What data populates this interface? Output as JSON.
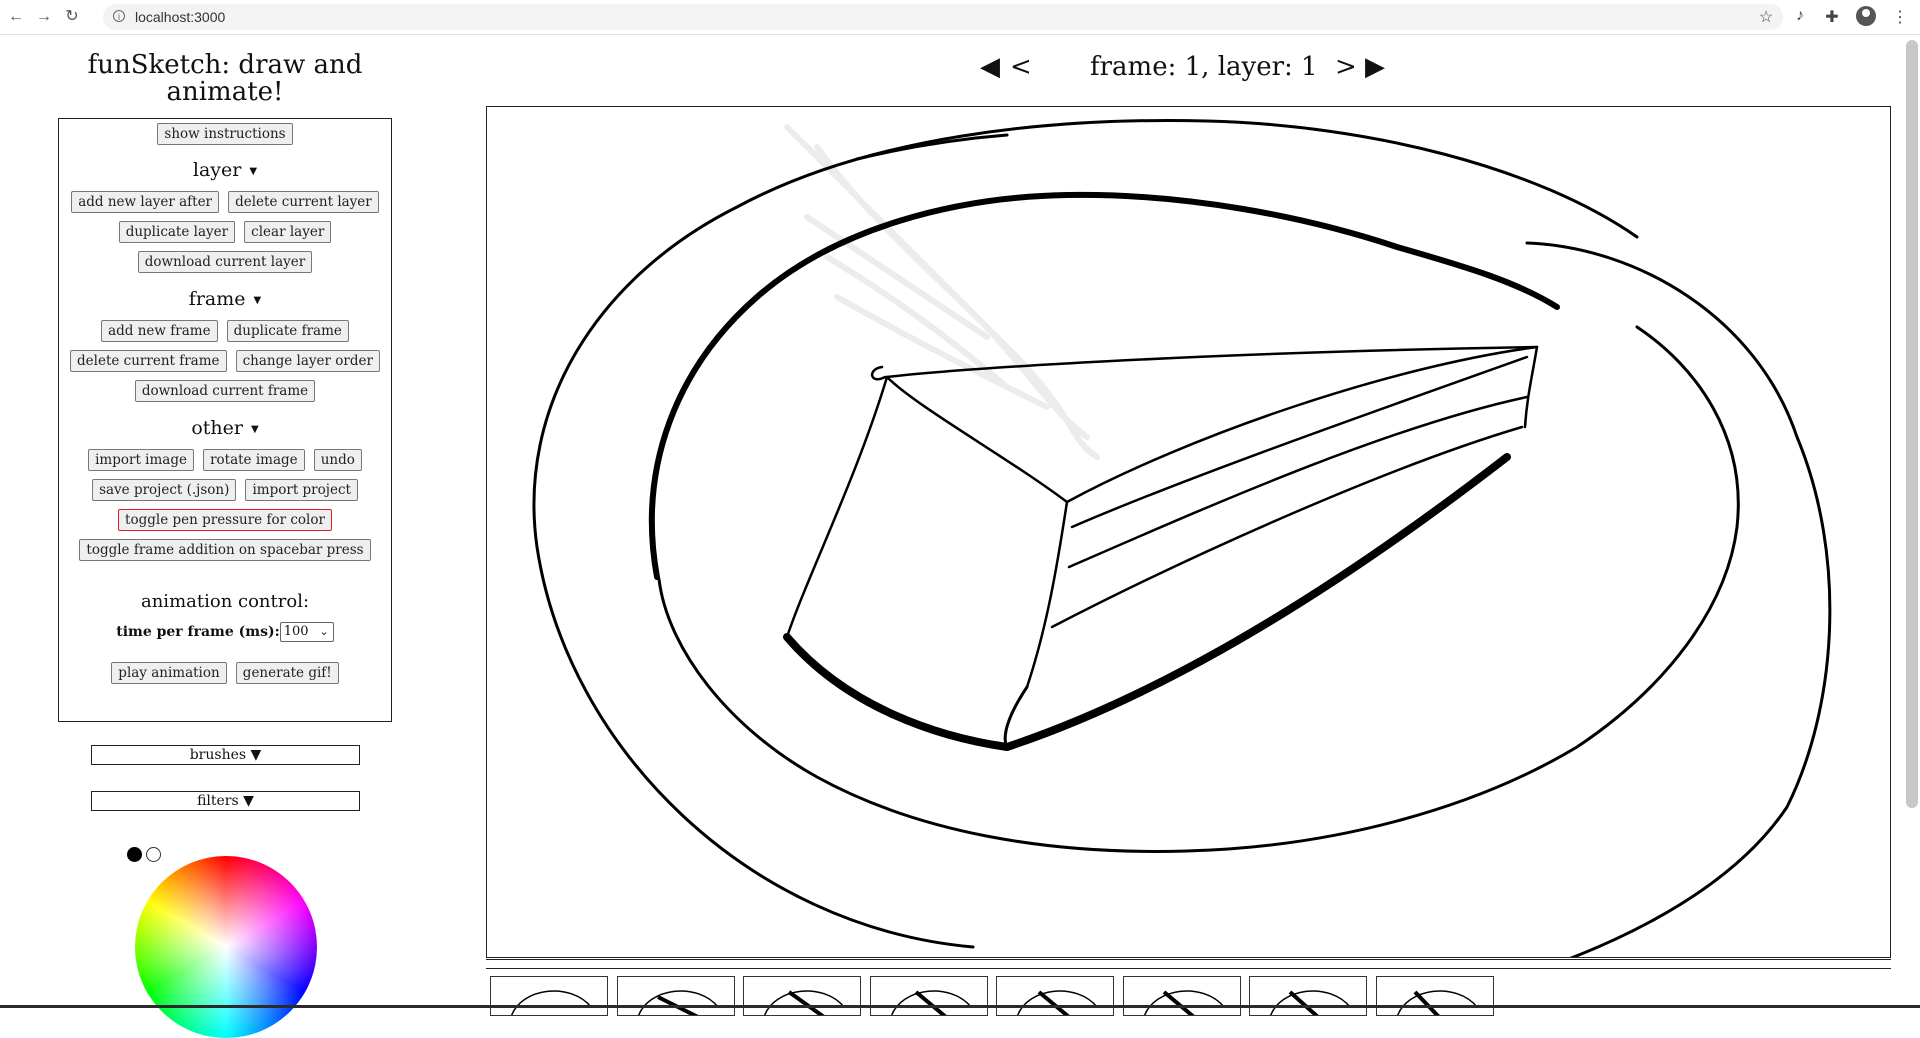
{
  "browser": {
    "url": "localhost:3000",
    "icons": [
      "back-icon",
      "forward-icon",
      "reload-icon",
      "site-info-icon",
      "star-icon",
      "extension-icon",
      "puzzle-icon",
      "profile-icon",
      "menu-icon"
    ]
  },
  "app": {
    "title": "funSketch: draw and animate!",
    "show_instructions": "show instructions",
    "layer": {
      "heading": "layer",
      "buttons": [
        "add new layer after",
        "delete current layer",
        "duplicate layer",
        "clear layer",
        "download current layer"
      ]
    },
    "frame": {
      "heading": "frame",
      "buttons": [
        "add new frame",
        "duplicate frame",
        "delete current frame",
        "change layer order",
        "download current frame"
      ]
    },
    "other": {
      "heading": "other",
      "buttons": [
        "import image",
        "rotate image",
        "undo",
        "save project (.json)",
        "import project",
        "toggle pen pressure for color",
        "toggle frame addition on spacebar press"
      ]
    },
    "animation": {
      "heading": "animation control:",
      "time_label": "time per frame (ms):",
      "time_value": "100",
      "play": "play animation",
      "gif": "generate gif!"
    },
    "brushes": "brushes ▼",
    "filters": "filters ▼",
    "colors": {
      "primary": "#000000",
      "secondary": "#ffffff"
    }
  },
  "nav": {
    "first": "◀",
    "prev": "<",
    "status": "frame: 1, layer: 1",
    "next": ">",
    "last": "▶"
  },
  "timeline": {
    "thumbnail_count": 8
  }
}
